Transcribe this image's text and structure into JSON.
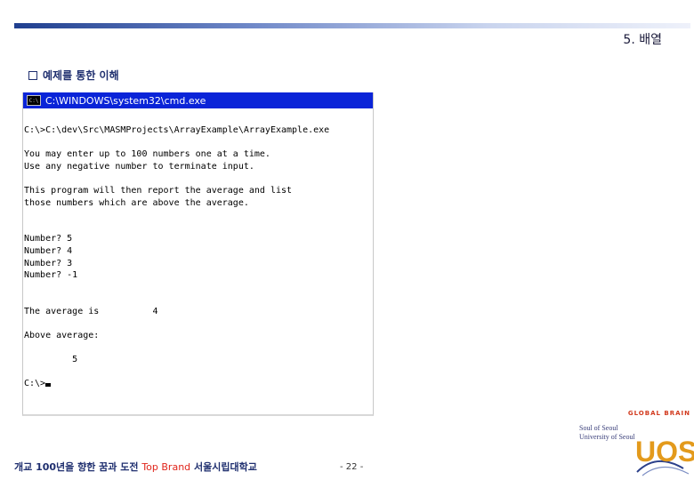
{
  "header": {
    "chapter_title": "5. 배열"
  },
  "section": {
    "title": "예제를 통한 이해"
  },
  "console": {
    "title": "C:\\WINDOWS\\system32\\cmd.exe",
    "icon_text": "C:\\",
    "lines": [
      "C:\\>C:\\dev\\Src\\MASMProjects\\ArrayExample\\ArrayExample.exe",
      "",
      "You may enter up to 100 numbers one at a time.",
      "Use any negative number to terminate input.",
      "",
      "This program will then report the average and list",
      "those numbers which are above the average.",
      "",
      "",
      "Number? 5",
      "Number? 4",
      "Number? 3",
      "Number? -1",
      "",
      "",
      "The average is          4",
      "",
      "Above average:",
      "",
      "         5",
      "",
      "C:\\>"
    ]
  },
  "footer": {
    "left_text": "개교 100년을 향한 꿈과 도전",
    "brand": "Top Brand",
    "university": "서울시립대학교",
    "page": "- 22 -"
  },
  "logo": {
    "global": "GLOBAL BRAIN",
    "line1": "Soul of Seoul",
    "line2": "University of Seoul",
    "mark": "UOS"
  },
  "colors": {
    "title_bar": "#0a24d8",
    "brand_red": "#e0251b",
    "navy": "#1f2f6f"
  }
}
